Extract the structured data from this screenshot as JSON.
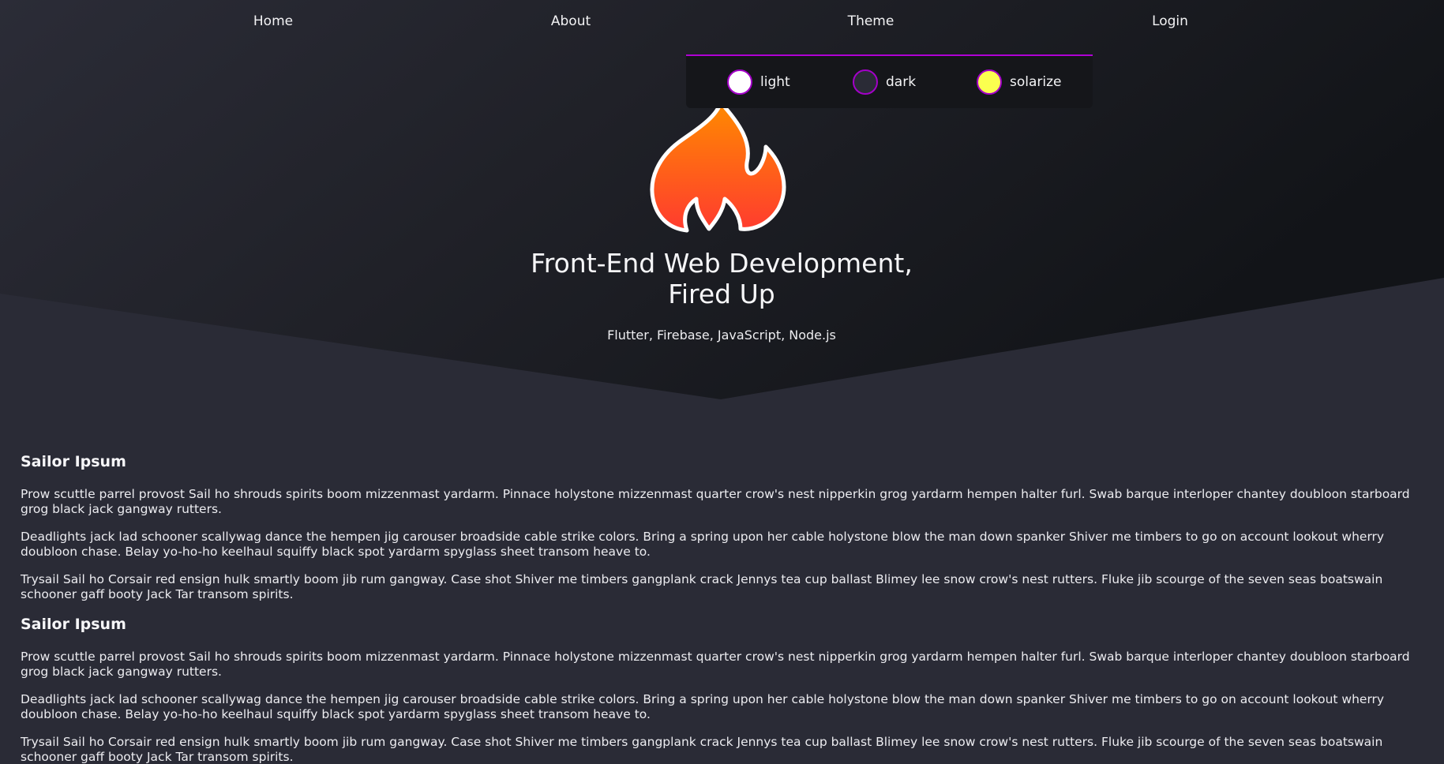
{
  "nav": {
    "items": [
      "Home",
      "About",
      "Theme",
      "Login"
    ]
  },
  "theme_menu": {
    "options": [
      {
        "label": "light",
        "color": "#ffffff"
      },
      {
        "label": "dark",
        "color": "#2a2b36"
      },
      {
        "label": "solarize",
        "color": "#fbff4f"
      }
    ],
    "accent": "#b000d4"
  },
  "hero": {
    "logo_icon": "fire-icon",
    "title_line1": "Front-End Web Development,",
    "title_line2": "Fired Up",
    "subtitle": "Flutter, Firebase, JavaScript, Node.js"
  },
  "sections": [
    {
      "heading": "Sailor Ipsum",
      "paragraphs": [
        "Prow scuttle parrel provost Sail ho shrouds spirits boom mizzenmast yardarm. Pinnace holystone mizzenmast quarter crow's nest nipperkin grog yardarm hempen halter furl. Swab barque interloper chantey doubloon starboard grog black jack gangway rutters.",
        "Deadlights jack lad schooner scallywag dance the hempen jig carouser broadside cable strike colors. Bring a spring upon her cable holystone blow the man down spanker Shiver me timbers to go on account lookout wherry doubloon chase. Belay yo-ho-ho keelhaul squiffy black spot yardarm spyglass sheet transom heave to.",
        "Trysail Sail ho Corsair red ensign hulk smartly boom jib rum gangway. Case shot Shiver me timbers gangplank crack Jennys tea cup ballast Blimey lee snow crow's nest rutters. Fluke jib scourge of the seven seas boatswain schooner gaff booty Jack Tar transom spirits."
      ]
    },
    {
      "heading": "Sailor Ipsum",
      "paragraphs": [
        "Prow scuttle parrel provost Sail ho shrouds spirits boom mizzenmast yardarm. Pinnace holystone mizzenmast quarter crow's nest nipperkin grog yardarm hempen halter furl. Swab barque interloper chantey doubloon starboard grog black jack gangway rutters.",
        "Deadlights jack lad schooner scallywag dance the hempen jig carouser broadside cable strike colors. Bring a spring upon her cable holystone blow the man down spanker Shiver me timbers to go on account lookout wherry doubloon chase. Belay yo-ho-ho keelhaul squiffy black spot yardarm spyglass sheet transom heave to.",
        "Trysail Sail ho Corsair red ensign hulk smartly boom jib rum gangway. Case shot Shiver me timbers gangplank crack Jennys tea cup ballast Blimey lee snow crow's nest rutters. Fluke jib scourge of the seven seas boatswain schooner gaff booty Jack Tar transom spirits."
      ]
    }
  ]
}
